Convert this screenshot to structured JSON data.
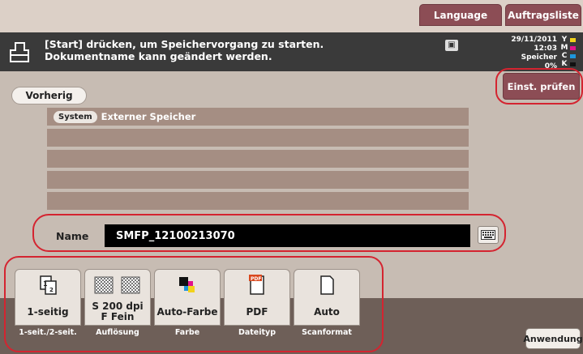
{
  "header": {
    "language_label": "Language",
    "jobs_label": "Auftragsliste"
  },
  "message": {
    "text": "[Start] drücken, um Speichervorgang zu starten.\nDokumentname kann geändert werden."
  },
  "status": {
    "date": "29/11/2011",
    "time": "12:03",
    "memory_label": "Speicher",
    "memory_value": "0%",
    "toner": [
      {
        "letter": "Y",
        "color": "#f2d21b"
      },
      {
        "letter": "M",
        "color": "#e0138c"
      },
      {
        "letter": "C",
        "color": "#1e96dc"
      },
      {
        "letter": "K",
        "color": "#111111"
      }
    ]
  },
  "nav": {
    "back_label": "Vorherig",
    "check_settings_label": "Einst. prüfen"
  },
  "storage": {
    "system_chip": "System",
    "path_label": "Externer Speicher"
  },
  "document": {
    "name_label": "Name",
    "name_value": "SMFP_12100213070"
  },
  "settings": [
    {
      "value": "1-seitig",
      "caption": "1-seit./2-seit.",
      "icon": "simplex-icon"
    },
    {
      "value": "S 200 dpi\nF Fein",
      "caption": "Auflösung",
      "icon": "resolution-icon"
    },
    {
      "value": "Auto-Farbe",
      "caption": "Farbe",
      "icon": "color-icon"
    },
    {
      "value": "PDF",
      "caption": "Dateityp",
      "icon": "pdf-icon"
    },
    {
      "value": "Auto",
      "caption": "Scanformat",
      "icon": "page-size-icon"
    }
  ],
  "footer": {
    "apply_label": "Anwendung"
  },
  "colors": {
    "accent": "#8c4d55",
    "highlight_ring": "#d42430",
    "list_row": "#a58e83",
    "background": "#c7bcb3"
  }
}
